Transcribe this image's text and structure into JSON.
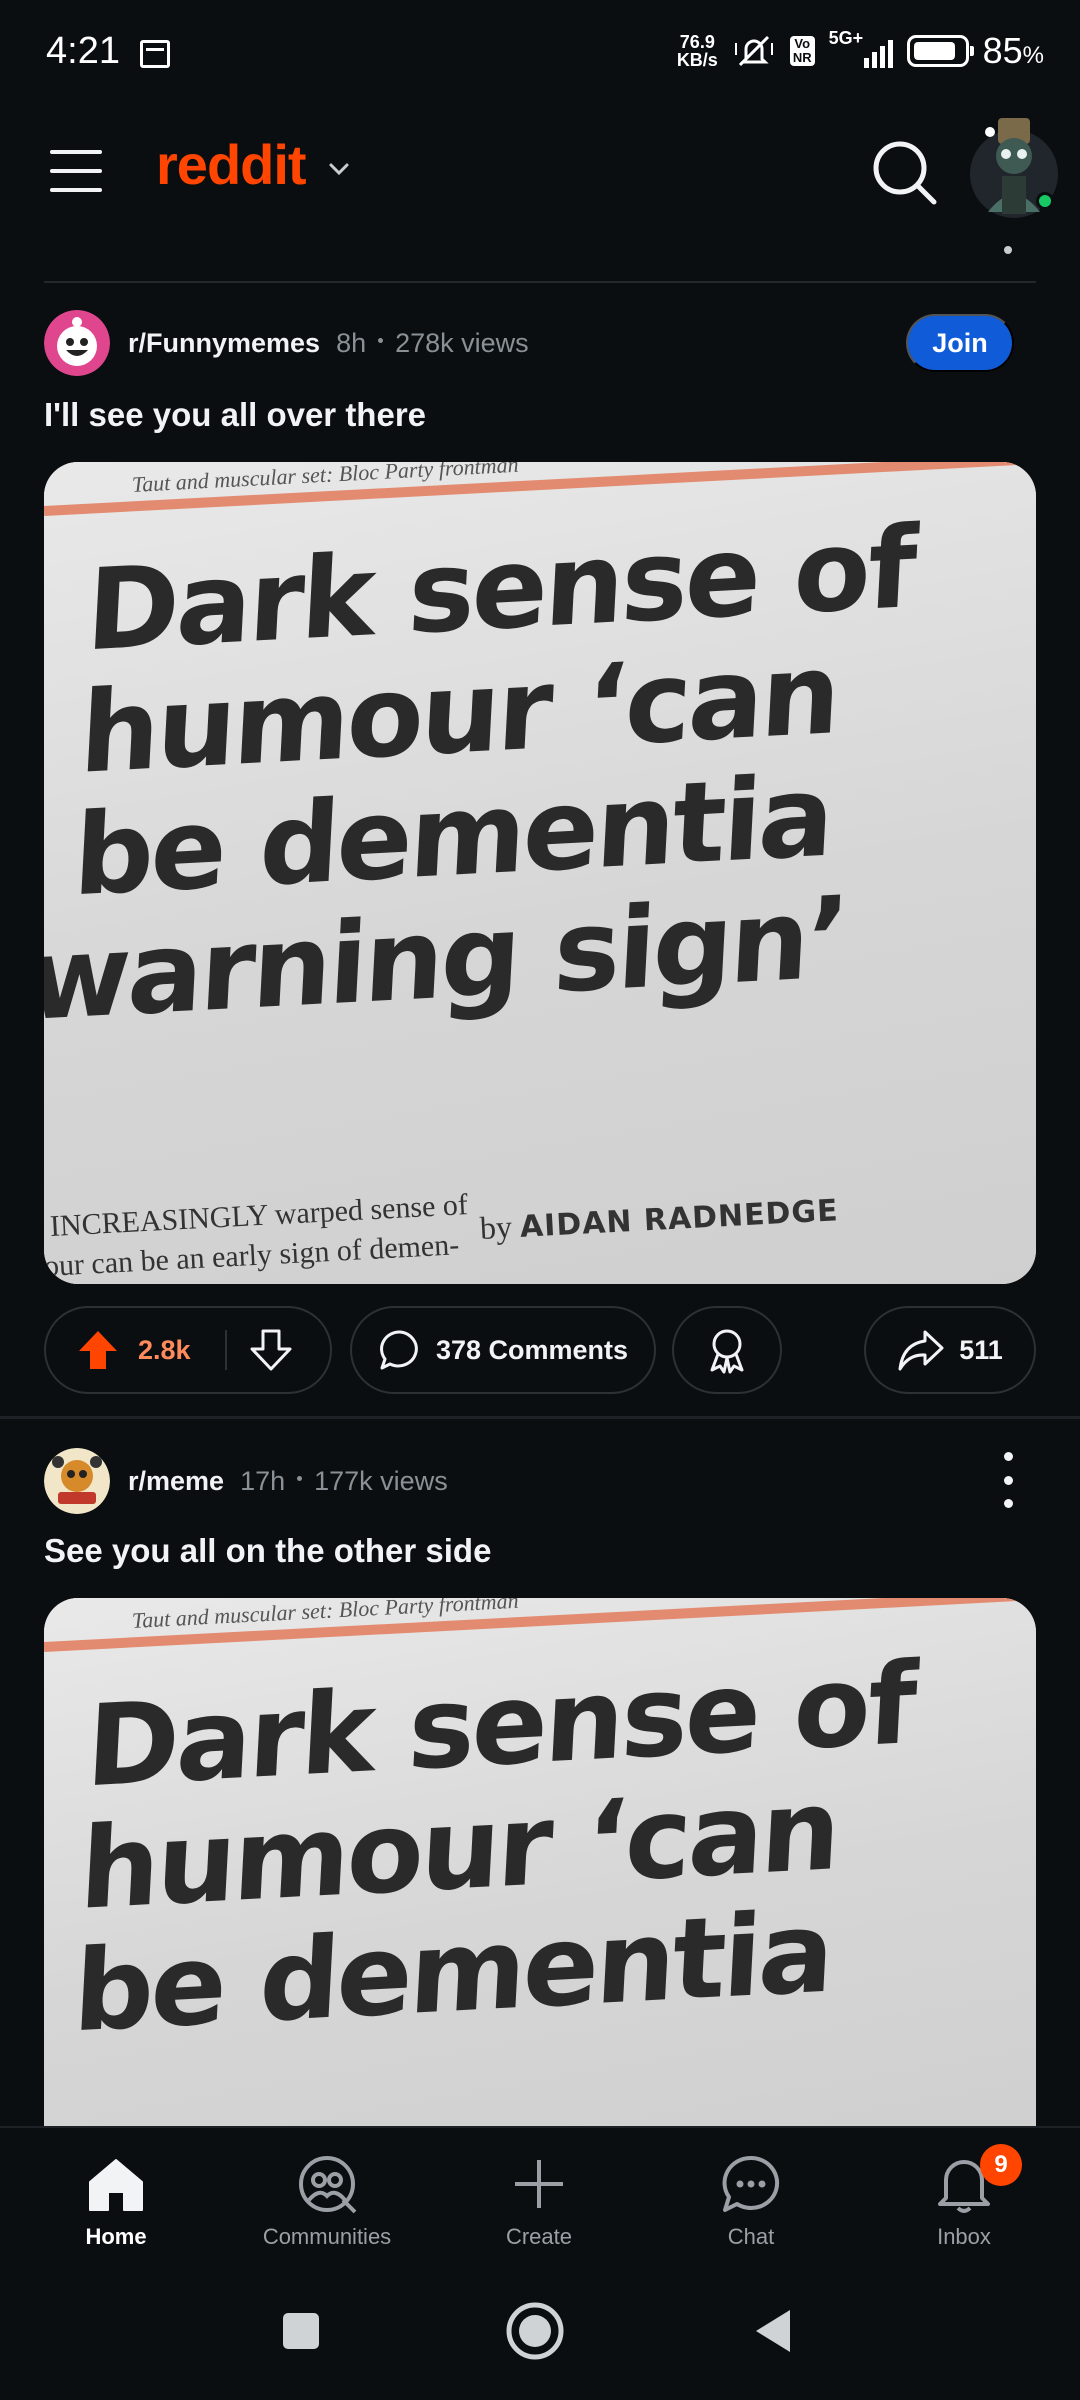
{
  "status_bar": {
    "time": "4:21",
    "net_speed_value": "76.9",
    "net_speed_unit": "KB/s",
    "volte_top": "Vo",
    "volte_bottom": "NR",
    "network": "5G+",
    "battery_percent": "85",
    "battery_unit": "%",
    "battery_level": 0.85
  },
  "header": {
    "brand": "reddit",
    "icons": [
      "menu-icon",
      "chevron-down-icon",
      "search-icon",
      "avatar"
    ]
  },
  "posts": [
    {
      "subreddit": "r/Funnymemes",
      "age": "8h",
      "views": "278k views",
      "join_label": "Join",
      "title": "I'll see you all over there",
      "image": {
        "kicker": "Taut and muscular set: Bloc Party frontman",
        "headline_lines": [
          "Dark sense of",
          "humour ‘can",
          "be dementia",
          "warning sign’"
        ],
        "body_lines": [
          "INCREASINGLY warped sense of",
          "our can be an early sign of demen-"
        ],
        "byline_prefix": "by",
        "byline_name": "AIDAN RADNEDGE"
      },
      "votes": "2.8k",
      "comments_label": "378 Comments",
      "shares": "511"
    },
    {
      "subreddit": "r/meme",
      "age": "17h",
      "views": "177k views",
      "title": "See you all on the other side",
      "image": {
        "kicker": "Taut and muscular set: Bloc Party frontman",
        "headline_lines": [
          "Dark sense of",
          "humour ‘can",
          "be dementia"
        ]
      }
    }
  ],
  "bottom_nav": [
    {
      "label": "Home",
      "icon": "home-icon",
      "active": true
    },
    {
      "label": "Communities",
      "icon": "communities-icon",
      "active": false
    },
    {
      "label": "Create",
      "icon": "plus-icon",
      "active": false
    },
    {
      "label": "Chat",
      "icon": "chat-icon",
      "active": false
    },
    {
      "label": "Inbox",
      "icon": "bell-icon",
      "active": false,
      "badge": "9"
    }
  ],
  "system_nav": [
    "recents-square-icon",
    "home-circle-icon",
    "back-triangle-icon"
  ],
  "colors": {
    "background": "#0b0e10",
    "brand": "#ff4500",
    "join_button": "#0f5bd8",
    "upvote": "#ff4500",
    "vote_count": "#ff8a5b",
    "muted_text": "#8a9196"
  }
}
